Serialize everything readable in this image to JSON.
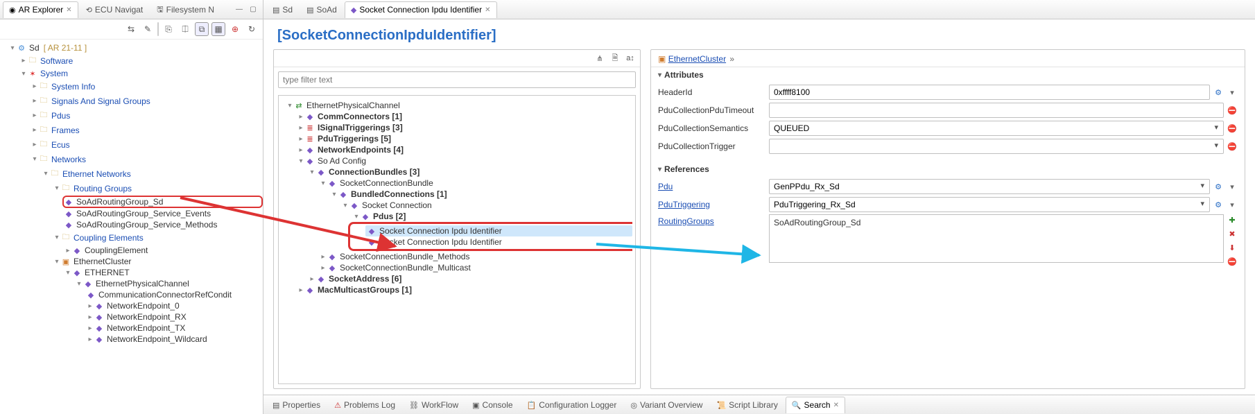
{
  "left_tabs": {
    "items": [
      {
        "label": "AR Explorer",
        "icon": "◉",
        "active": true
      },
      {
        "label": "ECU Navigat",
        "icon": "⟲",
        "active": false
      },
      {
        "label": "Filesystem N",
        "icon": "🖫",
        "active": false
      }
    ]
  },
  "left_toolbar": {
    "buttons": [
      "⇆",
      "✎",
      "⎘",
      "⎅",
      "⧉",
      "▦",
      "⊕",
      "↻"
    ]
  },
  "left_tree": {
    "root": {
      "label": "Sd",
      "suffix": "[ AR 21-11 ]"
    },
    "software": "Software",
    "system": "System",
    "system_children": {
      "system_info": "System Info",
      "signals": "Signals And Signal Groups",
      "pdus": "Pdus",
      "frames": "Frames",
      "ecus": "Ecus",
      "networks": "Networks"
    },
    "eth_networks": "Ethernet Networks",
    "routing_groups": "Routing Groups",
    "rg_items": {
      "sd": "SoAdRoutingGroup_Sd",
      "se": "SoAdRoutingGroup_Service_Events",
      "sm": "SoAdRoutingGroup_Service_Methods"
    },
    "coupling_elements": "Coupling Elements",
    "coupling_element": "CouplingElement",
    "ethernet_cluster": "EthernetCluster",
    "ethernet": "ETHERNET",
    "epc": "EthernetPhysicalChannel",
    "epc_children": {
      "ccrc": "CommunicationConnectorRefCondit",
      "ne0": "NetworkEndpoint_0",
      "ne_rx": "NetworkEndpoint_RX",
      "ne_tx": "NetworkEndpoint_TX",
      "ne_wc": "NetworkEndpoint_Wildcard"
    }
  },
  "editor_tabs": {
    "items": [
      {
        "label": "Sd",
        "active": false
      },
      {
        "label": "SoAd",
        "active": false
      },
      {
        "label": "Socket Connection Ipdu Identifier",
        "active": true
      }
    ]
  },
  "editor_header": "[SocketConnectionIpduIdentifier]",
  "filter_placeholder": "type filter text",
  "mid_tree": {
    "epc": "EthernetPhysicalChannel",
    "comm": {
      "label": "CommConnectors",
      "count": "[1]"
    },
    "isig": {
      "label": "ISignalTriggerings",
      "count": "[3]"
    },
    "pdutr": {
      "label": "PduTriggerings",
      "count": "[5]"
    },
    "nwe": {
      "label": "NetworkEndpoints",
      "count": "[4]"
    },
    "soad": "So Ad Config",
    "cbund": {
      "label": "ConnectionBundles",
      "count": "[3]"
    },
    "scb": "SocketConnectionBundle",
    "bcon": {
      "label": "BundledConnections",
      "count": "[1]"
    },
    "scon": "Socket Connection",
    "pdus": {
      "label": "Pdus",
      "count": "[2]"
    },
    "scii1": "Socket Connection Ipdu Identifier",
    "scii2": "Socket Connection Ipdu Identifier",
    "scbm": "SocketConnectionBundle_Methods",
    "scbmc": "SocketConnectionBundle_Multicast",
    "saddr": {
      "label": "SocketAddress",
      "count": "[6]"
    },
    "mcg": {
      "label": "MacMulticastGroups",
      "count": "[1]"
    }
  },
  "breadcrumb": {
    "label": "EthernetCluster"
  },
  "sections": {
    "attributes": "Attributes",
    "references": "References"
  },
  "attrs": {
    "header_id": {
      "label": "HeaderId",
      "value": "0xffff8100"
    },
    "pct": {
      "label": "PduCollectionPduTimeout"
    },
    "pcs": {
      "label": "PduCollectionSemantics",
      "value": "QUEUED"
    },
    "pctr": {
      "label": "PduCollectionTrigger",
      "value": ""
    }
  },
  "refs": {
    "pdu": {
      "label": "Pdu",
      "value": "GenPPdu_Rx_Sd"
    },
    "pdutr": {
      "label": "PduTriggering",
      "value": "PduTriggering_Rx_Sd"
    },
    "rg": {
      "label": "RoutingGroups"
    },
    "rg_item": "SoAdRoutingGroup_Sd"
  },
  "bottom_tabs": {
    "items": [
      {
        "label": "Properties"
      },
      {
        "label": "Problems Log"
      },
      {
        "label": "WorkFlow"
      },
      {
        "label": "Console"
      },
      {
        "label": "Configuration Logger"
      },
      {
        "label": "Variant Overview"
      },
      {
        "label": "Script Library"
      },
      {
        "label": "Search",
        "active": true
      }
    ]
  }
}
